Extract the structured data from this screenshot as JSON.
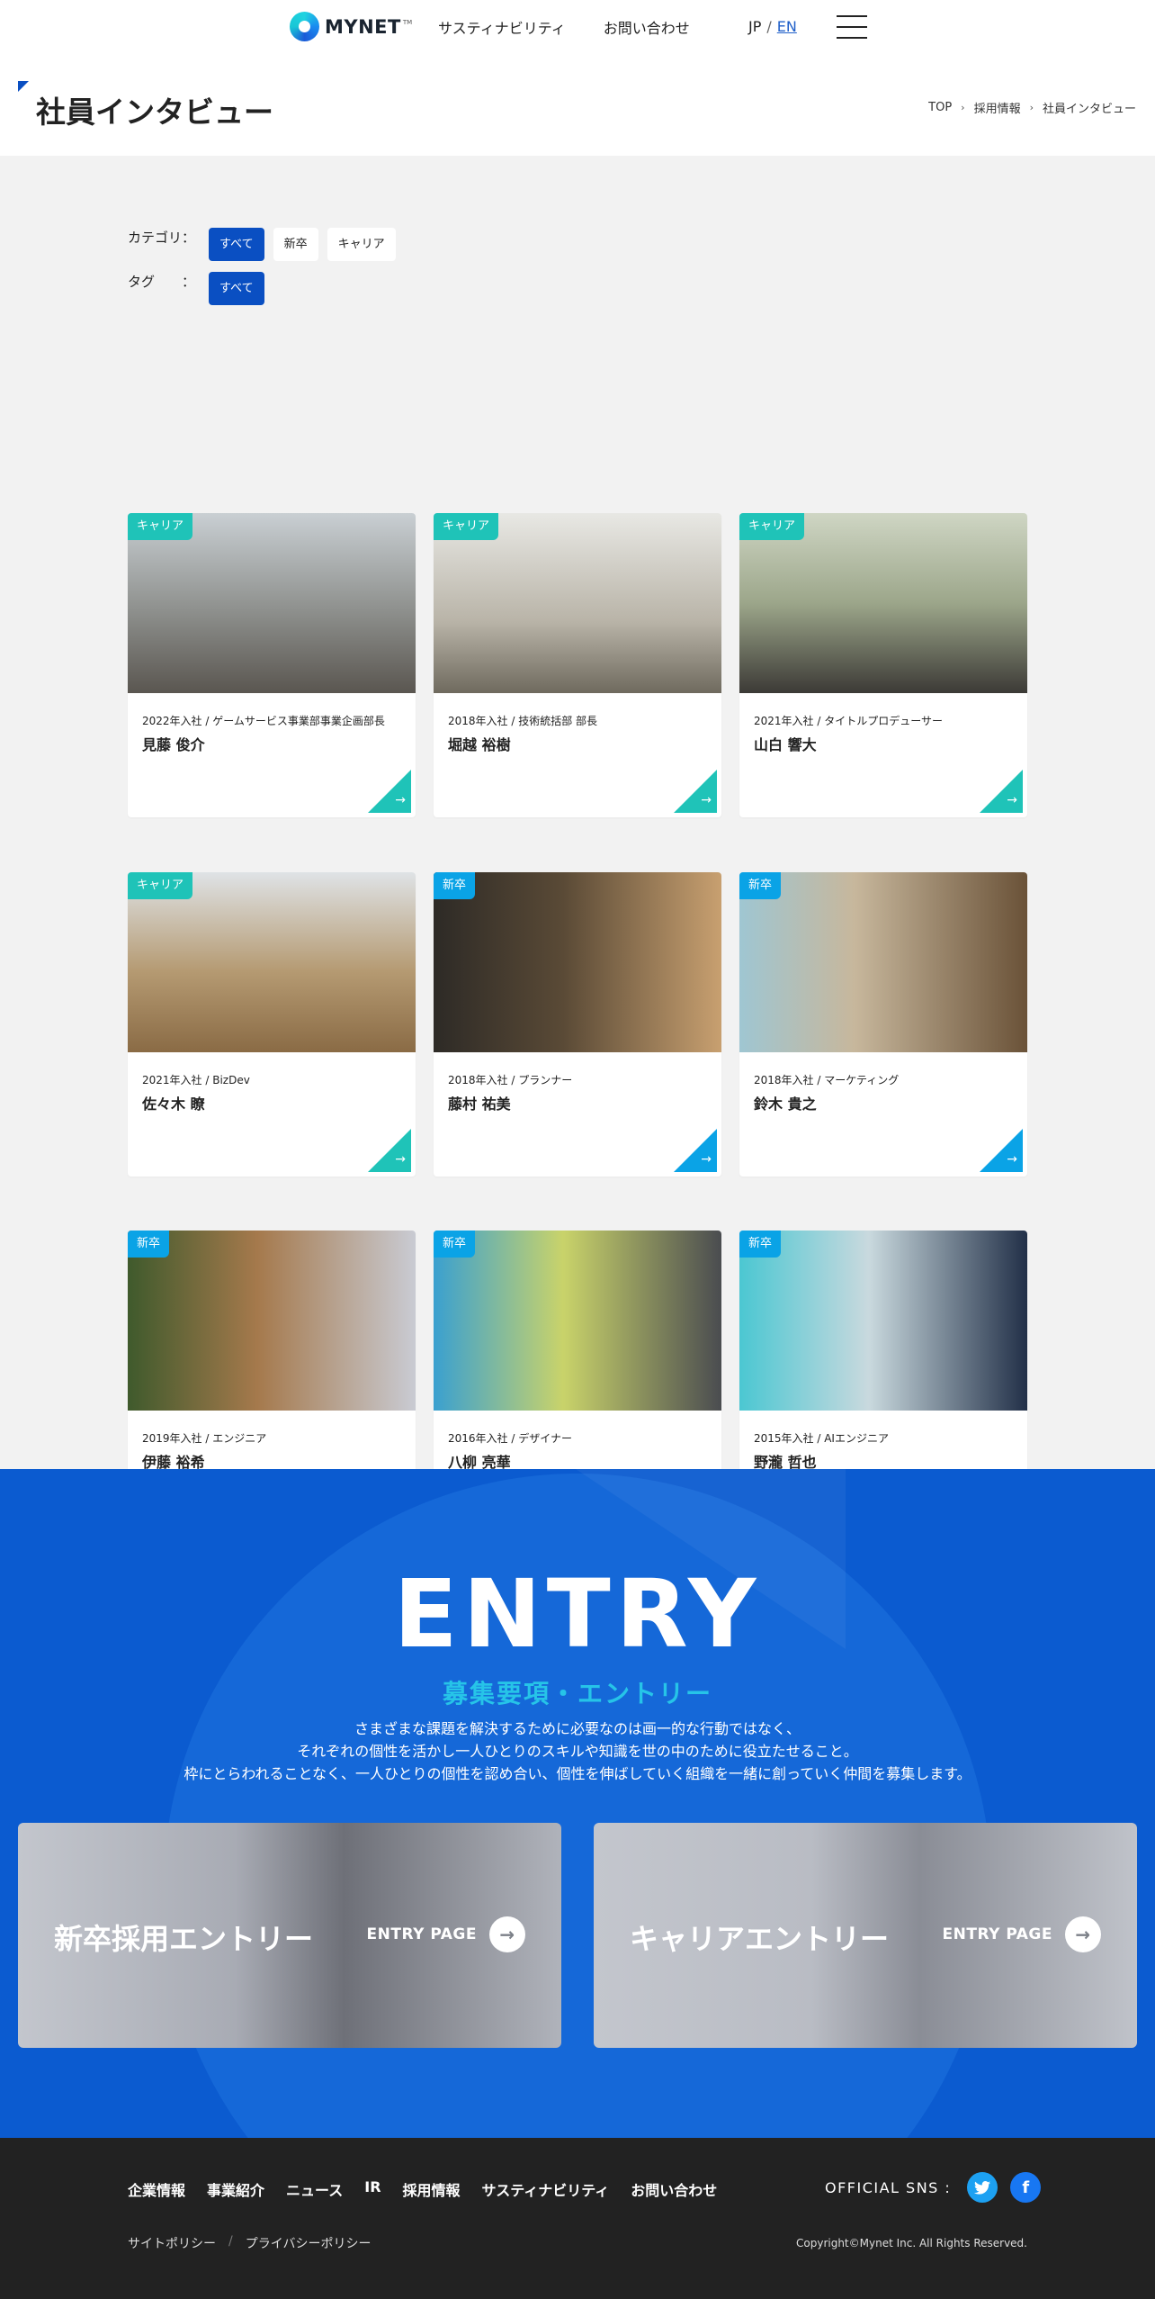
{
  "header": {
    "logo_text": "MYNET",
    "logo_sup": "TM",
    "nav": [
      "サスティナビリティ",
      "お問い合わせ"
    ],
    "lang_jp": "JP",
    "lang_sep": "/",
    "lang_en": "EN"
  },
  "page": {
    "title": "社員インタビュー",
    "breadcrumb": [
      "TOP",
      "採用情報",
      "社員インタビュー"
    ]
  },
  "filters": {
    "category_label": "カテゴリ",
    "tag_label": "タグ",
    "colon": "：",
    "category_options": [
      "すべて",
      "新卒",
      "キャリア"
    ],
    "tag_options": [
      "すべて"
    ]
  },
  "cards": [
    {
      "tag": "キャリア",
      "type": "career",
      "meta": "2022年入社 / ゲームサービス事業部事業企画部長",
      "name": "見藤 俊介"
    },
    {
      "tag": "キャリア",
      "type": "career",
      "meta": "2018年入社 / 技術統括部 部長",
      "name": "堀越 裕樹"
    },
    {
      "tag": "キャリア",
      "type": "career",
      "meta": "2021年入社 / タイトルプロデューサー",
      "name": "山白 響大"
    },
    {
      "tag": "キャリア",
      "type": "career",
      "meta": "2021年入社 / BizDev",
      "name": "佐々木 瞭"
    },
    {
      "tag": "新卒",
      "type": "new",
      "meta": "2018年入社 / プランナー",
      "name": "藤村 祐美"
    },
    {
      "tag": "新卒",
      "type": "new",
      "meta": "2018年入社 / マーケティング",
      "name": "鈴木 貴之"
    },
    {
      "tag": "新卒",
      "type": "new",
      "meta": "2019年入社 / エンジニア",
      "name": "伊藤 裕希"
    },
    {
      "tag": "新卒",
      "type": "new",
      "meta": "2016年入社 / デザイナー",
      "name": "八柳 亮華"
    },
    {
      "tag": "新卒",
      "type": "new",
      "meta": "2015年入社 / AIエンジニア",
      "name": "野瀧 哲也"
    }
  ],
  "entry": {
    "title": "ENTRY",
    "subtitle": "募集要項・エントリー",
    "desc": [
      "さまざまな課題を解決するために必要なのは画一的な行動ではなく、",
      "それぞれの個性を活かし一人ひとりのスキルや知識を世の中のために役立たせること。",
      "枠にとらわれることなく、一人ひとりの個性を認め合い、個性を伸ばしていく組織を一緒に創っていく仲間を募集します。"
    ],
    "new_grad_title": "新卒採用エントリー",
    "career_title": "キャリアエントリー",
    "link_label": "ENTRY PAGE"
  },
  "footer": {
    "nav": [
      "企業情報",
      "事業紹介",
      "ニュース",
      "IR",
      "採用情報",
      "サスティナビリティ",
      "お問い合わせ"
    ],
    "sns_label": "OFFICIAL SNS :",
    "twitter_icon": "twitter-icon",
    "facebook_icon": "facebook-icon",
    "policy": [
      "サイトポリシー",
      "プライバシーポリシー"
    ],
    "policy_sep": "/",
    "copyright": "Copyright©Mynet Inc. All Rights Reserved."
  },
  "colors": {
    "brand_blue": "#0a4fc2",
    "career_teal": "#1fc3b8",
    "new_blue": "#0aa3e6",
    "entry_bg": "#0b5bd0",
    "footer_bg": "#222222"
  }
}
